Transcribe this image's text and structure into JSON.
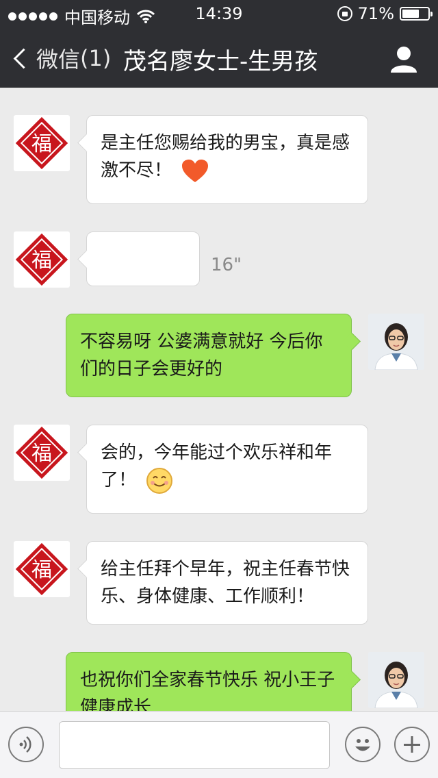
{
  "status_bar": {
    "carrier": "中国移动",
    "time": "14:39",
    "battery_percent": "71%",
    "battery_level": 0.71
  },
  "nav": {
    "back_label": "微信",
    "unread_count": "(1)",
    "title": "茂名廖女士-生男孩"
  },
  "messages": [
    {
      "side": "left",
      "text": "是主任您赐给我的男宝，真是感激不尽！",
      "emoji": "heart-icon"
    },
    {
      "side": "left",
      "type": "voice",
      "duration": "16\""
    },
    {
      "side": "right",
      "text": "不容易呀 公婆满意就好 今后你们的日子会更好的"
    },
    {
      "side": "left",
      "text": "会的，今年能过个欢乐祥和年了！",
      "emoji": "smiley-icon"
    },
    {
      "side": "left",
      "text": "给主任拜个早年，祝主任春节快乐、身体健康、工作顺利！"
    },
    {
      "side": "right",
      "text": "也祝你们全家春节快乐 祝小王子健康成长"
    }
  ],
  "avatar_glyph": "福",
  "colors": {
    "nav_bg": "#2e2f33",
    "chat_bg": "#ebebeb",
    "bubble_left": "#ffffff",
    "bubble_right": "#9fe65a",
    "fu_red": "#c8161d"
  }
}
